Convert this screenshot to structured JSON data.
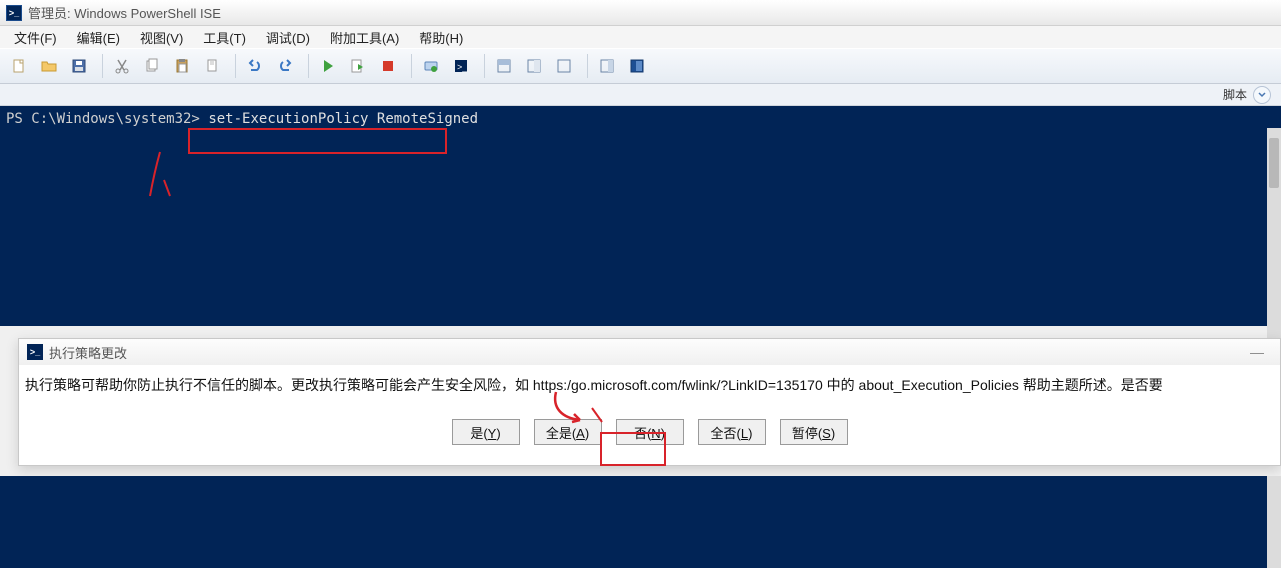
{
  "window": {
    "title": "管理员: Windows PowerShell ISE"
  },
  "menu": {
    "file": "文件(F)",
    "edit": "编辑(E)",
    "view": "视图(V)",
    "tools": "工具(T)",
    "debug": "调试(D)",
    "addons": "附加工具(A)",
    "help": "帮助(H)"
  },
  "script_pane_label": "脚本",
  "console": {
    "prompt": "PS C:\\Windows\\system32>",
    "command": "set-ExecutionPolicy RemoteSigned"
  },
  "dialog": {
    "title": "执行策略更改",
    "message": "执行策略可帮助你防止执行不信任的脚本。更改执行策略可能会产生安全风险，如 https:/go.microsoft.com/fwlink/?LinkID=135170 中的 about_Execution_Policies 帮助主题所述。是否要",
    "buttons": {
      "yes": "是(Y)",
      "yes_all": "全是(A)",
      "no": "否(N)",
      "no_all": "全否(L)",
      "suspend": "暂停(S)"
    }
  },
  "icons": {
    "ps_glyph": ">_"
  }
}
